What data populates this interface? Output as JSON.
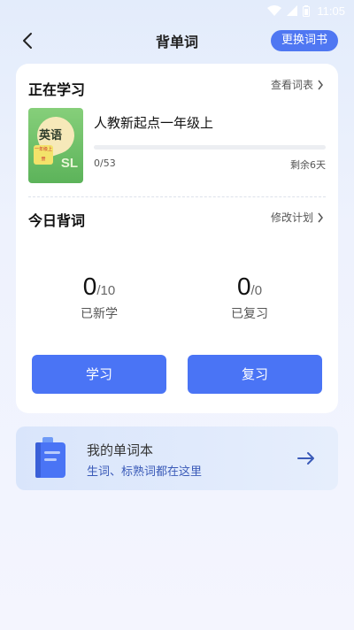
{
  "status_bar": {
    "time": "11:05"
  },
  "nav": {
    "title": "背单词",
    "switch_book_label": "更换词书"
  },
  "learning": {
    "section_title": "正在学习",
    "view_list_label": "查看词表",
    "book": {
      "cover_text": "英语",
      "cover_grade": "一年级上册",
      "cover_series": "SL",
      "name": "人教新起点一年级上",
      "progress_fraction": 0,
      "progress_count": "0/53",
      "remaining": "剩余6天"
    }
  },
  "today": {
    "section_title": "今日背词",
    "modify_plan_label": "修改计划",
    "new": {
      "value": "0",
      "total": "/10",
      "label": "已新学"
    },
    "review": {
      "value": "0",
      "total": "/0",
      "label": "已复习"
    },
    "study_button": "学习",
    "review_button": "复习"
  },
  "wordbook": {
    "title": "我的单词本",
    "subtitle": "生词、标熟词都在这里"
  },
  "colors": {
    "accent": "#4a74f5",
    "background": "#eef2fd",
    "card": "#ffffff"
  },
  "icons": [
    "wifi-icon",
    "signal-icon",
    "battery-icon",
    "back-arrow-icon",
    "chevron-right-icon",
    "notebook-icon",
    "arrow-right-icon"
  ]
}
